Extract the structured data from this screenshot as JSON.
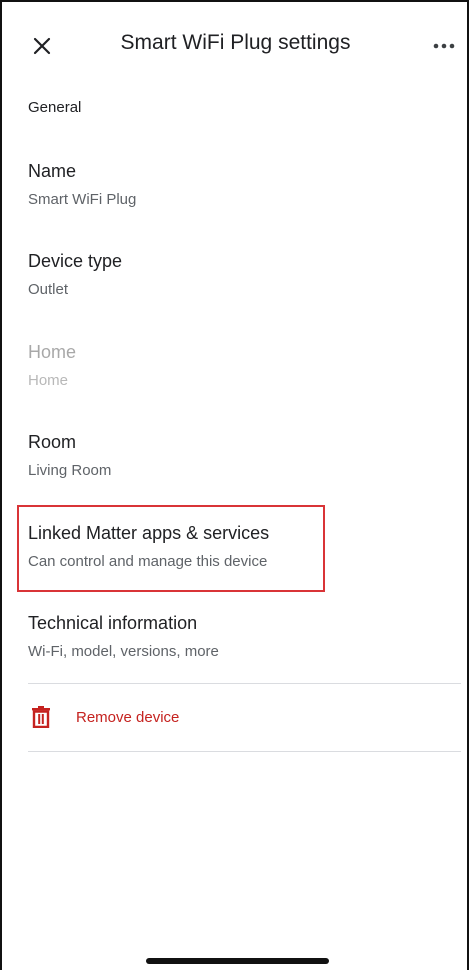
{
  "header": {
    "title": "Smart WiFi Plug settings",
    "close_icon": "close-icon",
    "more_icon": "more-horizontal-icon"
  },
  "section": {
    "heading": "General"
  },
  "settings": [
    {
      "id": "name",
      "label": "Name",
      "value": "Smart WiFi Plug"
    },
    {
      "id": "device-type",
      "label": "Device type",
      "value": "Outlet"
    },
    {
      "id": "home",
      "label": "Home",
      "value": "Home",
      "disabled": true
    },
    {
      "id": "room",
      "label": "Room",
      "value": "Living Room"
    },
    {
      "id": "linked-matter",
      "label": "Linked Matter apps & services",
      "value": "Can control and manage this device",
      "highlighted": true
    },
    {
      "id": "technical-info",
      "label": "Technical information",
      "value": "Wi-Fi, model, versions, more"
    }
  ],
  "remove": {
    "label": "Remove device",
    "icon": "trash-icon",
    "color": "#c5221f"
  },
  "colors": {
    "highlight": "#d93437",
    "text_primary": "#202124",
    "text_secondary": "#5f6368",
    "text_disabled": "#a8a8a8",
    "divider": "#dadce0"
  }
}
